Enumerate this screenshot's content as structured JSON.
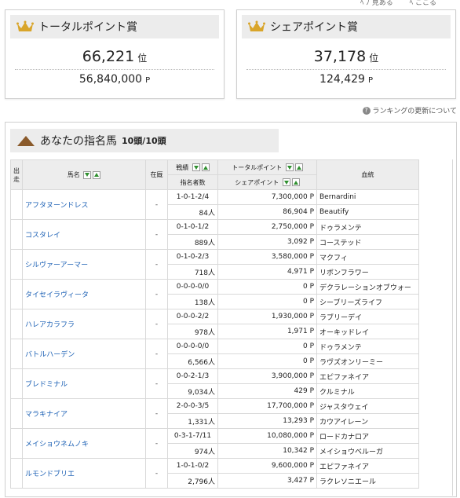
{
  "top_fragment": "ﾍ ﾉ 見ある　　 ﾍ ここる",
  "awards": [
    {
      "title": "トータルポイント賞",
      "rank": "66,221",
      "rank_unit": "位",
      "points": "56,840,000",
      "points_unit": "P"
    },
    {
      "title": "シェアポイント賞",
      "rank": "37,178",
      "rank_unit": "位",
      "points": "124,429",
      "points_unit": "P"
    }
  ],
  "help_link": "ランキングの更新について",
  "horses": {
    "title": "あなたの指名馬",
    "count": "10頭/10頭",
    "headers": {
      "start": "出走",
      "name": "馬名",
      "stable": "在厩",
      "record": "戦績",
      "nominees": "指名者数",
      "total_points": "トータルポイント",
      "share_points": "シェアポイント",
      "bloodline": "血統"
    },
    "rows": [
      {
        "name": "アフタヌーンドレス",
        "stable": "-",
        "record": "1-0-1-2/4",
        "nominees": "84人",
        "total": "7,300,000 P",
        "share": "86,904 P",
        "sire": "Bernardini",
        "dam": "Beautify"
      },
      {
        "name": "コスタレイ",
        "stable": "-",
        "record": "0-1-0-1/2",
        "nominees": "889人",
        "total": "2,750,000 P",
        "share": "3,092 P",
        "sire": "ドゥラメンテ",
        "dam": "コーステッド"
      },
      {
        "name": "シルヴァーアーマー",
        "stable": "-",
        "record": "0-1-0-2/3",
        "nominees": "718人",
        "total": "3,580,000 P",
        "share": "4,971 P",
        "sire": "マクフィ",
        "dam": "リボンフラワー"
      },
      {
        "name": "タイセイラヴィータ",
        "stable": "-",
        "record": "0-0-0-0/0",
        "nominees": "138人",
        "total": "0 P",
        "share": "0 P",
        "sire": "デクラレーションオブウォー",
        "dam": "シーブリーズライフ"
      },
      {
        "name": "ハレアカラフラ",
        "stable": "-",
        "record": "0-0-0-2/2",
        "nominees": "978人",
        "total": "1,930,000 P",
        "share": "1,971 P",
        "sire": "ラブリーデイ",
        "dam": "オーキッドレイ"
      },
      {
        "name": "バトルハーデン",
        "stable": "-",
        "record": "0-0-0-0/0",
        "nominees": "6,566人",
        "total": "0 P",
        "share": "0 P",
        "sire": "ドゥラメンテ",
        "dam": "ラヴズオンリーミー"
      },
      {
        "name": "ブレドミナル",
        "stable": "-",
        "record": "0-0-2-1/3",
        "nominees": "9,034人",
        "total": "3,900,000 P",
        "share": "429 P",
        "sire": "エピファネイア",
        "dam": "クルミナル"
      },
      {
        "name": "マラキナイア",
        "stable": "-",
        "record": "2-0-0-3/5",
        "nominees": "1,331人",
        "total": "17,700,000 P",
        "share": "13,293 P",
        "sire": "ジャスタウェイ",
        "dam": "カウアイレーン"
      },
      {
        "name": "メイショウネムノキ",
        "stable": "-",
        "record": "0-3-1-7/11",
        "nominees": "974人",
        "total": "10,080,000 P",
        "share": "10,342 P",
        "sire": "ロードカナロア",
        "dam": "メイショウベルーガ"
      },
      {
        "name": "ルモンドブリエ",
        "stable": "-",
        "record": "1-0-1-0/2",
        "nominees": "2,796人",
        "total": "9,600,000 P",
        "share": "3,427 P",
        "sire": "エピファネイア",
        "dam": "ラクレソニエール"
      }
    ]
  },
  "colors": {
    "crown": "#d9a52a",
    "link": "#1a5fb4",
    "sort_arrow": "#2f8f2f",
    "horse_logo": "#8a5a2b"
  },
  "icons": {
    "crown": "crown-icon",
    "horse": "horse-logo-icon",
    "help": "help-icon",
    "sort_down": "sort-down-icon",
    "sort_up": "sort-up-icon"
  }
}
